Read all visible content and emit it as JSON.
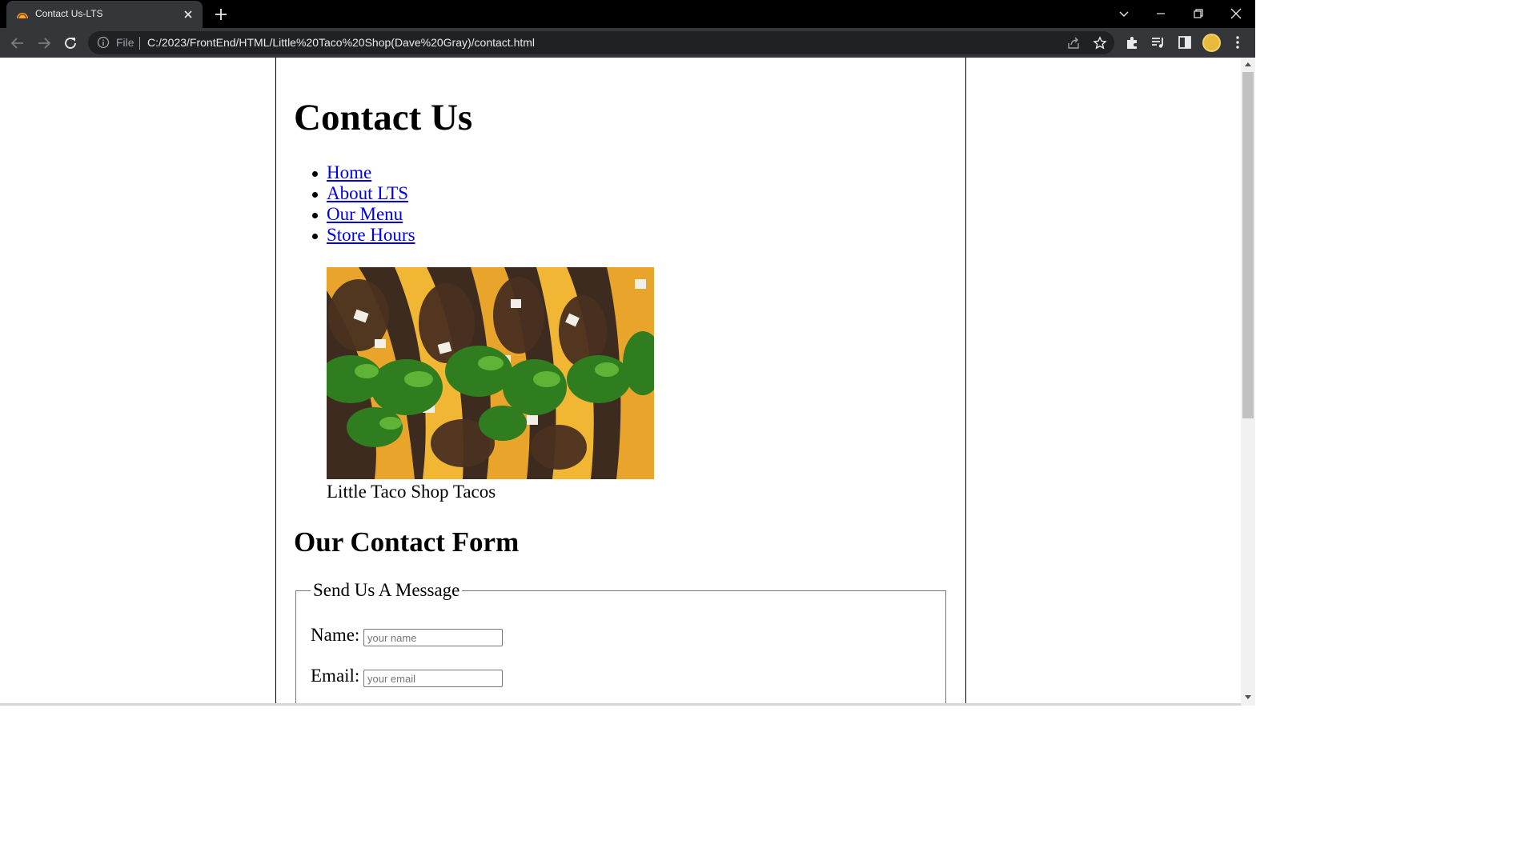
{
  "browser": {
    "tab": {
      "title": "Contact Us-LTS"
    },
    "address": {
      "scheme": "File",
      "url": "C:/2023/FrontEnd/HTML/Little%20Taco%20Shop(Dave%20Gray)/contact.html"
    }
  },
  "page": {
    "title": "Contact Us",
    "nav": [
      "Home",
      "About LTS",
      "Our Menu",
      "Store Hours"
    ],
    "figure": {
      "caption": "Little Taco Shop Tacos"
    },
    "form_heading": "Our Contact Form",
    "fieldset": {
      "legend": "Send Us A Message",
      "name": {
        "label": "Name:",
        "placeholder": "your name"
      },
      "email": {
        "label": "Email:",
        "placeholder": "your email"
      }
    }
  },
  "colors": {
    "link": "#0000ee",
    "chrome_dark": "#35363a",
    "omnibox": "#202124"
  }
}
